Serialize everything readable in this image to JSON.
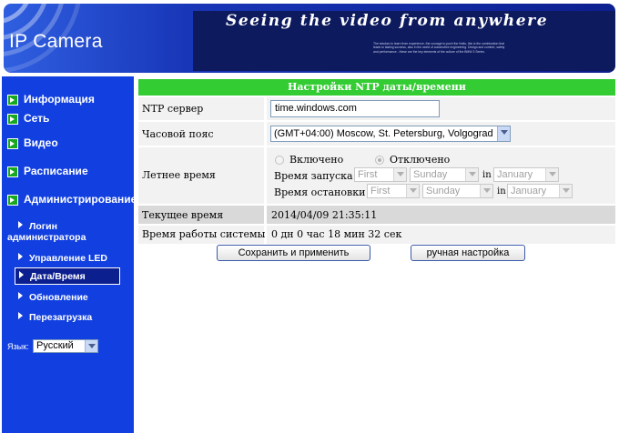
{
  "header": {
    "brand": "IP Camera",
    "slogan": "Seeing the video from anywhere",
    "fineprint": "The wisdom to learn from experience, the courage to push the limits, this is the combination that leads to lasting success, also in the world of automotive engineering. Design and comfort, safety and performance - these are the key elements of the culture of the BMW 3 Series."
  },
  "sidebar": {
    "items": [
      {
        "label": "Информация"
      },
      {
        "label": "Сеть"
      },
      {
        "label": "Видео"
      },
      {
        "label": "Расписание"
      },
      {
        "label": "Администрирование"
      }
    ],
    "subitems": [
      {
        "label": "Логин администратора"
      },
      {
        "label": "Управление LED"
      },
      {
        "label": "Дата/Время"
      },
      {
        "label": "Обновление"
      },
      {
        "label": "Перезагрузка"
      }
    ],
    "language_label": "Язык:",
    "language_value": "Русский"
  },
  "panel": {
    "title": "Настройки NTP даты/времени",
    "ntp_label": "NTP сервер",
    "ntp_value": "time.windows.com",
    "tz_label": "Часовой пояс",
    "tz_value": "(GMT+04:00) Moscow, St. Petersburg, Volgograd",
    "dst_label": "Летнее время",
    "dst_on": "Включено",
    "dst_off": "Отключено",
    "start_label": "Время запуска :",
    "stop_label": "Время остановки :",
    "start": {
      "week": "First",
      "day": "Sunday",
      "in": "in",
      "month": "January"
    },
    "stop": {
      "week": "First",
      "day": "Sunday",
      "in": "in",
      "month": "January"
    },
    "current_label": "Текущее время",
    "current_value": "2014/04/09 21:35:11",
    "uptime_label": "Время работы системы",
    "uptime_value": "0 дн 0 час 18 мин 32 сек"
  },
  "buttons": {
    "save": "Сохранить и применить",
    "manual": "ручная настройка"
  }
}
